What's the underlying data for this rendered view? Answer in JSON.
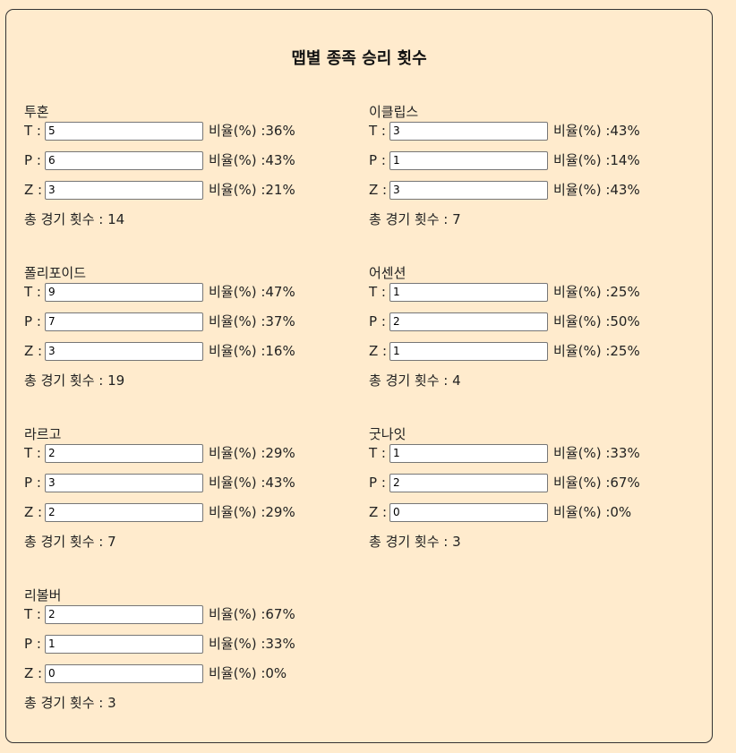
{
  "page": {
    "title": "맵별 종족 승리 횟수"
  },
  "labels": {
    "ratio": "비율(%) : ",
    "total": "총 경기 횟수 : "
  },
  "maps": [
    {
      "name": "투혼",
      "races": [
        {
          "label": "T : ",
          "value": "5",
          "ratio": "36%"
        },
        {
          "label": "P : ",
          "value": "6",
          "ratio": "43%"
        },
        {
          "label": "Z : ",
          "value": "3",
          "ratio": "21%"
        }
      ],
      "total": "14"
    },
    {
      "name": "이클립스",
      "races": [
        {
          "label": "T : ",
          "value": "3",
          "ratio": "43%"
        },
        {
          "label": "P : ",
          "value": "1",
          "ratio": "14%"
        },
        {
          "label": "Z : ",
          "value": "3",
          "ratio": "43%"
        }
      ],
      "total": "7"
    },
    {
      "name": "폴리포이드",
      "races": [
        {
          "label": "T : ",
          "value": "9",
          "ratio": "47%"
        },
        {
          "label": "P : ",
          "value": "7",
          "ratio": "37%"
        },
        {
          "label": "Z : ",
          "value": "3",
          "ratio": "16%"
        }
      ],
      "total": "19"
    },
    {
      "name": "어센션",
      "races": [
        {
          "label": "T : ",
          "value": "1",
          "ratio": "25%"
        },
        {
          "label": "P : ",
          "value": "2",
          "ratio": "50%"
        },
        {
          "label": "Z : ",
          "value": "1",
          "ratio": "25%"
        }
      ],
      "total": "4"
    },
    {
      "name": "라르고",
      "races": [
        {
          "label": "T : ",
          "value": "2",
          "ratio": "29%"
        },
        {
          "label": "P : ",
          "value": "3",
          "ratio": "43%"
        },
        {
          "label": "Z : ",
          "value": "2",
          "ratio": "29%"
        }
      ],
      "total": "7"
    },
    {
      "name": "굿나잇",
      "races": [
        {
          "label": "T : ",
          "value": "1",
          "ratio": "33%"
        },
        {
          "label": "P : ",
          "value": "2",
          "ratio": "67%"
        },
        {
          "label": "Z : ",
          "value": "0",
          "ratio": "0%"
        }
      ],
      "total": "3"
    },
    {
      "name": "리볼버",
      "races": [
        {
          "label": "T : ",
          "value": "2",
          "ratio": "67%"
        },
        {
          "label": "P : ",
          "value": "1",
          "ratio": "33%"
        },
        {
          "label": "Z : ",
          "value": "0",
          "ratio": "0%"
        }
      ],
      "total": "3"
    }
  ]
}
